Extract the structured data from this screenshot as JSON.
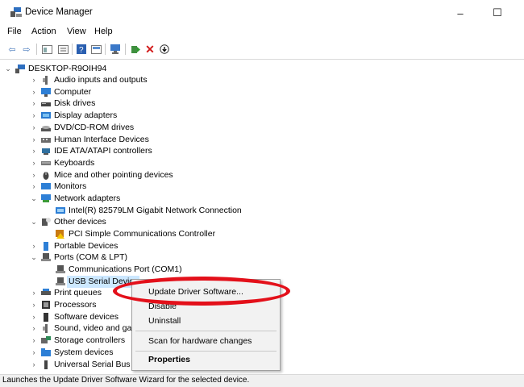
{
  "window": {
    "title": "Device Manager",
    "minimize": "–",
    "maximize": "☐",
    "close": "✕"
  },
  "menu": [
    "File",
    "Action",
    "View",
    "Help"
  ],
  "tree": [
    {
      "label": "DESKTOP-R9OIH94",
      "expander": "open",
      "icon": "computer-icon"
    },
    {
      "label": "Audio inputs and outputs",
      "expander": "closed",
      "icon": "speaker-icon"
    },
    {
      "label": "Computer",
      "expander": "closed",
      "icon": "monitor-icon"
    },
    {
      "label": "Disk drives",
      "expander": "closed",
      "icon": "disk-icon"
    },
    {
      "label": "Display adapters",
      "expander": "closed",
      "icon": "display-adapter-icon"
    },
    {
      "label": "DVD/CD-ROM drives",
      "expander": "closed",
      "icon": "dvd-icon"
    },
    {
      "label": "Human Interface Devices",
      "expander": "closed",
      "icon": "hid-icon"
    },
    {
      "label": "IDE ATA/ATAPI controllers",
      "expander": "closed",
      "icon": "ide-icon"
    },
    {
      "label": "Keyboards",
      "expander": "closed",
      "icon": "keyboard-icon"
    },
    {
      "label": "Mice and other pointing devices",
      "expander": "closed",
      "icon": "mouse-icon"
    },
    {
      "label": "Monitors",
      "expander": "closed",
      "icon": "monitor-icon"
    },
    {
      "label": "Network adapters",
      "expander": "open",
      "icon": "network-icon"
    },
    {
      "label": "Intel(R) 82579LM Gigabit Network Connection",
      "expander": "none",
      "icon": "network-card-icon"
    },
    {
      "label": "Other devices",
      "expander": "open",
      "icon": "unknown-device-icon"
    },
    {
      "label": "PCI Simple Communications Controller",
      "expander": "none",
      "icon": "warning-device-icon"
    },
    {
      "label": "Portable Devices",
      "expander": "closed",
      "icon": "portable-device-icon"
    },
    {
      "label": "Ports (COM & LPT)",
      "expander": "open",
      "icon": "port-icon"
    },
    {
      "label": "Communications Port (COM1)",
      "expander": "none",
      "icon": "port-icon"
    },
    {
      "label": "USB Serial Device",
      "expander": "none",
      "icon": "port-icon",
      "selected": true
    },
    {
      "label": "Print queues",
      "expander": "closed",
      "icon": "printer-icon"
    },
    {
      "label": "Processors",
      "expander": "closed",
      "icon": "processor-icon"
    },
    {
      "label": "Software devices",
      "expander": "closed",
      "icon": "software-device-icon"
    },
    {
      "label": "Sound, video and game controllers",
      "expander": "closed",
      "icon": "speaker-icon"
    },
    {
      "label": "Storage controllers",
      "expander": "closed",
      "icon": "storage-icon"
    },
    {
      "label": "System devices",
      "expander": "closed",
      "icon": "system-folder-icon"
    },
    {
      "label": "Universal Serial Bus controllers",
      "expander": "closed",
      "icon": "usb-icon"
    }
  ],
  "context_menu": {
    "update_driver": "Update Driver Software...",
    "disable": "Disable",
    "uninstall": "Uninstall",
    "scan": "Scan for hardware changes",
    "properties": "Properties"
  },
  "status_bar": "Launches the Update Driver Software Wizard for the selected device.",
  "colors": {
    "highlight": "#cce8ff",
    "annotation": "#e3101a"
  }
}
